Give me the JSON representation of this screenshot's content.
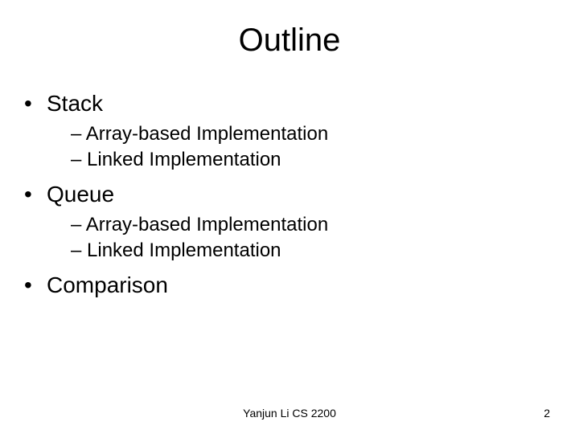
{
  "title": "Outline",
  "items": {
    "i0": {
      "label": "Stack"
    },
    "i0s0": "Array-based Implementation",
    "i0s1": "Linked Implementation",
    "i1": {
      "label": "Queue"
    },
    "i1s0": "Array-based Implementation",
    "i1s1": "Linked Implementation",
    "i2": {
      "label": "Comparison"
    }
  },
  "footer": {
    "center": "Yanjun Li CS 2200",
    "page": "2"
  },
  "glyphs": {
    "bullet": "•",
    "dash": "–"
  }
}
